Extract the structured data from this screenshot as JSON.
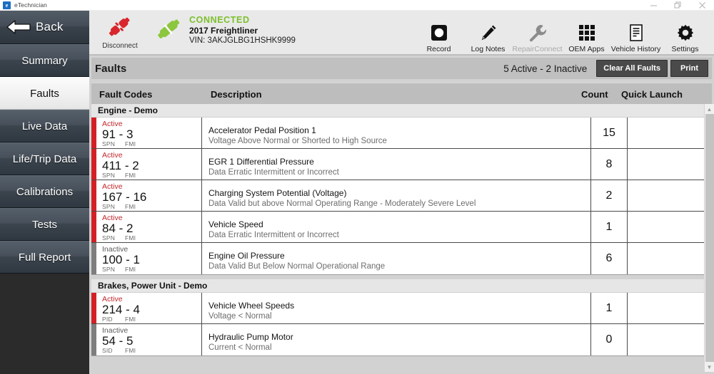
{
  "window": {
    "app_icon": "e-logo-icon",
    "title": "eTechnician",
    "minimize": "–",
    "restore": "restore-icon",
    "close": "✕"
  },
  "header": {
    "back_label": "Back",
    "disconnect_label": "Disconnect",
    "connection": {
      "status": "CONNECTED",
      "status_color": "#7cbf2c",
      "vehicle": "2017 Freightliner",
      "vin": "VIN: 3AKJGLBG1HSHK9999"
    },
    "tools": [
      {
        "label": "Record",
        "icon": "record-icon",
        "disabled": false
      },
      {
        "label": "Log Notes",
        "icon": "pencil-icon",
        "disabled": false
      },
      {
        "label": "RepairConnect",
        "icon": "wrench-icon",
        "disabled": true
      },
      {
        "label": "OEM Apps",
        "icon": "grid-icon",
        "disabled": false
      },
      {
        "label": "Vehicle History",
        "icon": "document-icon",
        "disabled": false
      },
      {
        "label": "Settings",
        "icon": "gear-icon",
        "disabled": false
      }
    ]
  },
  "sidebar": {
    "items": [
      {
        "label": "Summary",
        "selected": false
      },
      {
        "label": "Faults",
        "selected": true
      },
      {
        "label": "Live Data",
        "selected": false
      },
      {
        "label": "Life/Trip Data",
        "selected": false
      },
      {
        "label": "Calibrations",
        "selected": false
      },
      {
        "label": "Tests",
        "selected": false
      },
      {
        "label": "Full Report",
        "selected": false
      }
    ]
  },
  "main": {
    "page_title": "Faults",
    "counts_summary": "5 Active - 2 Inactive",
    "clear_all_label": "Clear All Faults",
    "print_label": "Print",
    "columns": {
      "codes": "Fault Codes",
      "description": "Description",
      "count": "Count",
      "quick_launch": "Quick Launch"
    },
    "groups": [
      {
        "name": "Engine - Demo",
        "rows": [
          {
            "status": "Active",
            "code": "91 - 3",
            "abbr1": "SPN",
            "abbr2": "FMI",
            "title": "Accelerator Pedal Position 1",
            "subtitle": "Voltage Above Normal or Shorted to High Source",
            "count": "15"
          },
          {
            "status": "Active",
            "code": "411 - 2",
            "abbr1": "SPN",
            "abbr2": "FMI",
            "title": "EGR 1 Differential Pressure",
            "subtitle": "Data Erratic Intermittent or Incorrect",
            "count": "8"
          },
          {
            "status": "Active",
            "code": "167 - 16",
            "abbr1": "SPN",
            "abbr2": "FMI",
            "title": "Charging System Potential (Voltage)",
            "subtitle": "Data Valid but above Normal Operating Range - Moderately Severe Level",
            "count": "2"
          },
          {
            "status": "Active",
            "code": "84 - 2",
            "abbr1": "SPN",
            "abbr2": "FMI",
            "title": "Vehicle Speed",
            "subtitle": "Data Erratic Intermittent or Incorrect",
            "count": "1"
          },
          {
            "status": "Inactive",
            "code": "100 - 1",
            "abbr1": "SPN",
            "abbr2": "FMI",
            "title": "Engine Oil Pressure",
            "subtitle": "Data Valid But Below Normal Operational Range",
            "count": "6"
          }
        ]
      },
      {
        "name": "Brakes, Power Unit - Demo",
        "rows": [
          {
            "status": "Active",
            "code": "214 - 4",
            "abbr1": "PID",
            "abbr2": "FMI",
            "title": "Vehicle Wheel Speeds",
            "subtitle": "Voltage < Normal",
            "count": "1"
          },
          {
            "status": "Inactive",
            "code": "54 - 5",
            "abbr1": "SID",
            "abbr2": "FMI",
            "title": "Hydraulic Pump Motor",
            "subtitle": "Current < Normal",
            "count": "0"
          }
        ]
      }
    ],
    "scrollbar": {
      "up": "▲",
      "down": "▼"
    }
  },
  "colors": {
    "active": "#d32026",
    "inactive": "#7e7e7e",
    "connected": "#7cbf2c"
  }
}
